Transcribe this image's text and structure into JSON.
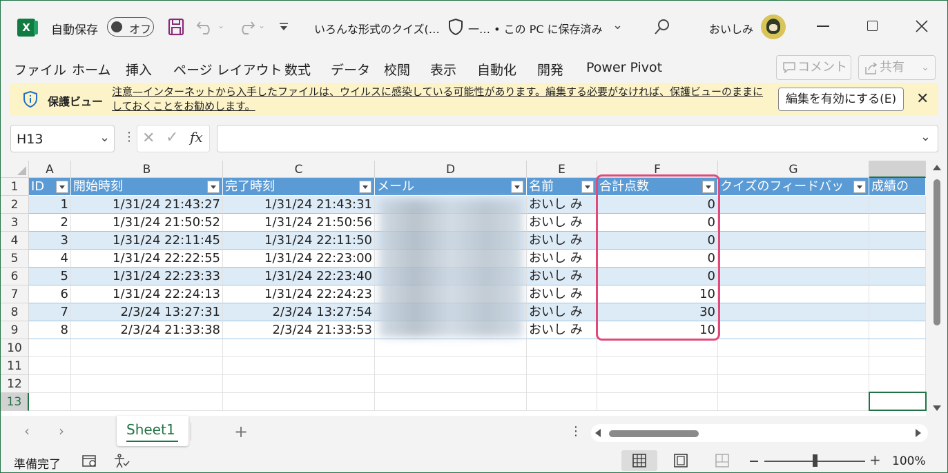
{
  "titlebar": {
    "autosave_label": "自動保存",
    "autosave_state": "オフ",
    "file_title": "いろんな形式のクイズ(…",
    "sensitivity": "一… • この PC に保存済み",
    "user_name": "おいしみ"
  },
  "menu": {
    "items": [
      "ファイル",
      "ホーム",
      "挿入",
      "ページ レイアウト",
      "数式",
      "データ",
      "校閲",
      "表示",
      "自動化",
      "開発",
      "Power Pivot"
    ],
    "comment_label": "コメント",
    "share_label": "共有"
  },
  "protected_view": {
    "title": "保護ビュー",
    "message": "注意—インターネットから入手したファイルは、ウイルスに感染している可能性があります。編集する必要がなければ、保護ビューのままにしておくことをお勧めします。",
    "enable_button": "編集を有効にする(E)"
  },
  "formula_bar": {
    "name_box": "H13",
    "fx_label": "fx",
    "formula": ""
  },
  "grid": {
    "columns": [
      "A",
      "B",
      "C",
      "D",
      "E",
      "F",
      "G"
    ],
    "rows": [
      "1",
      "2",
      "3",
      "4",
      "5",
      "6",
      "7",
      "8",
      "9",
      "10",
      "11",
      "12",
      "13"
    ],
    "table_headers": [
      "ID",
      "開始時刻",
      "完了時刻",
      "メール",
      "名前",
      "合計点数",
      "クイズのフィードバッ",
      "成績の"
    ],
    "data": [
      {
        "id": "1",
        "start": "1/31/24 21:43:27",
        "end": "1/31/24 21:43:31",
        "name": "おいし み",
        "score": "0"
      },
      {
        "id": "2",
        "start": "1/31/24 21:50:52",
        "end": "1/31/24 21:50:56",
        "name": "おいし み",
        "score": "0"
      },
      {
        "id": "3",
        "start": "1/31/24 22:11:45",
        "end": "1/31/24 22:11:50",
        "name": "おいし み",
        "score": "0"
      },
      {
        "id": "4",
        "start": "1/31/24 22:22:55",
        "end": "1/31/24 22:23:00",
        "name": "おいし み",
        "score": "0"
      },
      {
        "id": "5",
        "start": "1/31/24 22:23:33",
        "end": "1/31/24 22:23:40",
        "name": "おいし み",
        "score": "0"
      },
      {
        "id": "6",
        "start": "1/31/24 22:24:13",
        "end": "1/31/24 22:24:23",
        "name": "おいし み",
        "score": "10"
      },
      {
        "id": "7",
        "start": "2/3/24 13:27:31",
        "end": "2/3/24 13:27:54",
        "name": "おいし み",
        "score": "30"
      },
      {
        "id": "8",
        "start": "2/3/24 21:33:38",
        "end": "2/3/24 21:33:53",
        "name": "おいし み",
        "score": "10"
      }
    ]
  },
  "sheets": {
    "active": "Sheet1"
  },
  "statusbar": {
    "ready": "準備完了",
    "zoom": "100%"
  },
  "colors": {
    "excel_green": "#217346",
    "table_header": "#5b9bd5",
    "table_band": "#ddebf7",
    "highlight": "#e0497a",
    "protected_bg": "#fcf3c8"
  }
}
